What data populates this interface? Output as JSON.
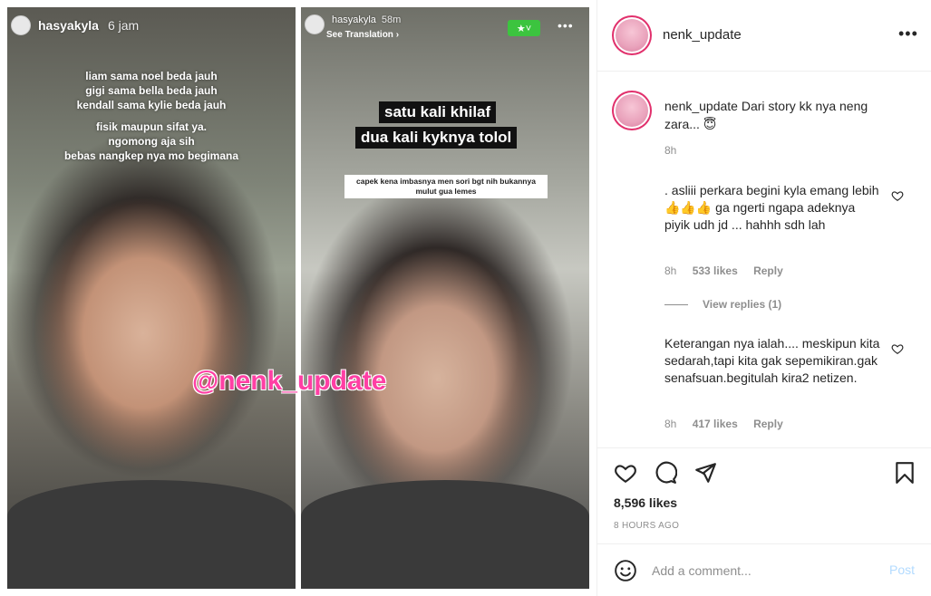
{
  "story_left": {
    "username": "hasyakyla",
    "time": "6 jam",
    "lines": [
      "liam sama noel beda jauh",
      "gigi sama bella beda jauh",
      "kendall sama kylie beda jauh",
      "fisik maupun sifat ya.",
      "ngomong aja sih",
      "bebas nangkep nya mo begimana"
    ]
  },
  "story_right": {
    "username": "hasyakyla",
    "time": "58m",
    "see_translation": "See Translation ›",
    "caption_line1": "satu kali khilaf",
    "caption_line2": "dua kali kyknya tolol",
    "note": "capek kena imbasnya men sori bgt nih bukannya mulut gua lemes"
  },
  "watermark": "@nenk_update",
  "header": {
    "username": "nenk_update"
  },
  "caption": {
    "username": "nenk_update",
    "text": "Dari story kk nya neng zara... 😇",
    "time": "8h"
  },
  "comments": [
    {
      "text": ". asliii perkara begini kyla emang lebih 👍👍👍 ga ngerti ngapa adeknya piyik udh jd ... hahhh sdh lah",
      "time": "8h",
      "likes": "533 likes",
      "reply": "Reply"
    },
    {
      "text": "Keterangan nya ialah.... meskipun kita sedarah,tapi kita gak sepemikiran.gak senafsuan.begitulah kira2 netizen.",
      "time": "8h",
      "likes": "417 likes",
      "reply": "Reply"
    }
  ],
  "view_replies": "View replies (1)",
  "likes": "8,596 likes",
  "posted": "8 HOURS AGO",
  "add_comment": {
    "placeholder": "Add a comment...",
    "post_label": "Post"
  }
}
